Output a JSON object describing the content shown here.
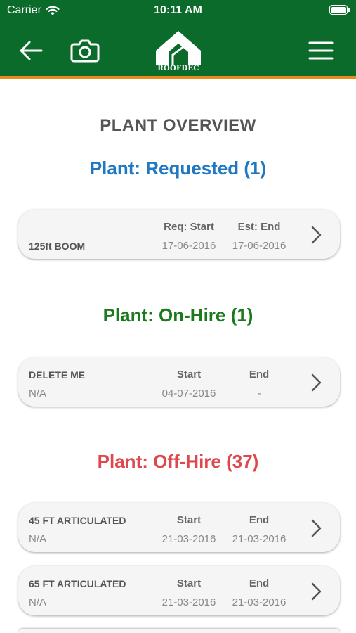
{
  "status_bar": {
    "carrier": "Carrier",
    "time": "10:11 AM"
  },
  "nav": {
    "logo_text": "ROOFDEC",
    "icons": [
      "back-arrow-icon",
      "camera-icon",
      "menu-icon"
    ]
  },
  "colors": {
    "header_green": "#0b6b2b",
    "accent_orange": "#e88a1e",
    "requested_blue": "#1f78c1",
    "on_hire_green": "#1b7a1b",
    "off_hire_red": "#e0474c"
  },
  "page_title": "PLANT OVERVIEW",
  "sections": [
    {
      "title": "Plant: Requested (1)",
      "items": [
        {
          "name": "125ft BOOM",
          "sub": "",
          "col1_label": "Req: Start",
          "col1_value": "17-06-2016",
          "col2_label": "Est: End",
          "col2_value": "17-06-2016"
        }
      ]
    },
    {
      "title": "Plant: On-Hire (1)",
      "items": [
        {
          "name": "DELETE ME",
          "sub": "N/A",
          "col1_label": "Start",
          "col1_value": "04-07-2016",
          "col2_label": "End",
          "col2_value": "-"
        }
      ]
    },
    {
      "title": "Plant: Off-Hire (37)",
      "items": [
        {
          "name": "45 FT ARTICULATED",
          "sub": "N/A",
          "col1_label": "Start",
          "col1_value": "21-03-2016",
          "col2_label": "End",
          "col2_value": "21-03-2016"
        },
        {
          "name": "65 FT ARTICULATED",
          "sub": "N/A",
          "col1_label": "Start",
          "col1_value": "21-03-2016",
          "col2_label": "End",
          "col2_value": "21-03-2016"
        }
      ]
    }
  ]
}
